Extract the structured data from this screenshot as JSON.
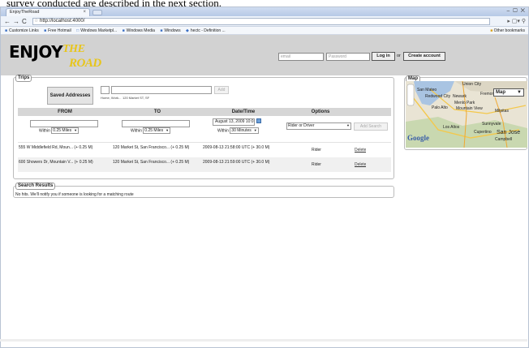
{
  "caption": "survey conducted are described in the next section.",
  "browser": {
    "tab_title": "EnjoyTheRoad",
    "tab_close": "×",
    "window_buttons": "⎯ ▢ ✕",
    "url": "http://localhost:4000/",
    "bookmarks": [
      "Customize Links",
      "Free Hotmail",
      "Windows Marketpl...",
      "Windows Media",
      "Windows",
      "hectc - Definition ..."
    ],
    "other_bookmarks": "Other bookmarks"
  },
  "header": {
    "logo_enjoy": "ENJOY",
    "logo_the": "THE",
    "logo_road": "ROAD",
    "email_placeholder": "email",
    "password_placeholder": "Password",
    "login_label": "Log in",
    "or_label": "or",
    "create_label": "Create account"
  },
  "trips": {
    "legend": "Trips",
    "saved_label": "Saved Addresses",
    "addr_hint1": "Home, Work...",
    "addr_hint2": "120 Market ST, SF",
    "add_label": "Add",
    "columns": {
      "from": "FROM",
      "to": "TO",
      "datetime": "Date/Time",
      "options": "Options"
    },
    "within_label": "Within",
    "miles_value": "0.25 Miles",
    "datetime_value": "August 13, 2009 10:0",
    "minutes_value": "30 Minutes",
    "role_value": "Rider or Driver",
    "search_label": "Add Search",
    "rows": [
      {
        "from": "555 W Middlefield Rd, Moun... (+ 0.25 M)",
        "to": "120 Market St, San Francisco... (+ 0.25 M)",
        "datetime": "2009-08-13 21:58:00 UTC (+ 30.0 M)",
        "role": "Rider",
        "delete": "Delete"
      },
      {
        "from": "600 Showers Dr, Mountain V... (+ 0.25 M)",
        "to": "120 Market St, San Francisco... (+ 0.25 M)",
        "datetime": "2009-08-13 21:59:00 UTC (+ 30.0 M)",
        "role": "Rider",
        "delete": "Delete"
      }
    ]
  },
  "search": {
    "legend": "Search Results",
    "message": "No hits. We'll notify you if someone is looking for a matching route"
  },
  "map": {
    "legend": "Map",
    "type_value": "Map",
    "google_label": "Google",
    "labels": [
      "Union City",
      "San Mateo",
      "Fremont",
      "Newark",
      "Redwood City",
      "Menlo Park",
      "Palo Alto",
      "Mountain View",
      "Milpitas",
      "Sunnyvale",
      "Los Altos",
      "Cupertino",
      "San Jose",
      "Campbell"
    ]
  }
}
